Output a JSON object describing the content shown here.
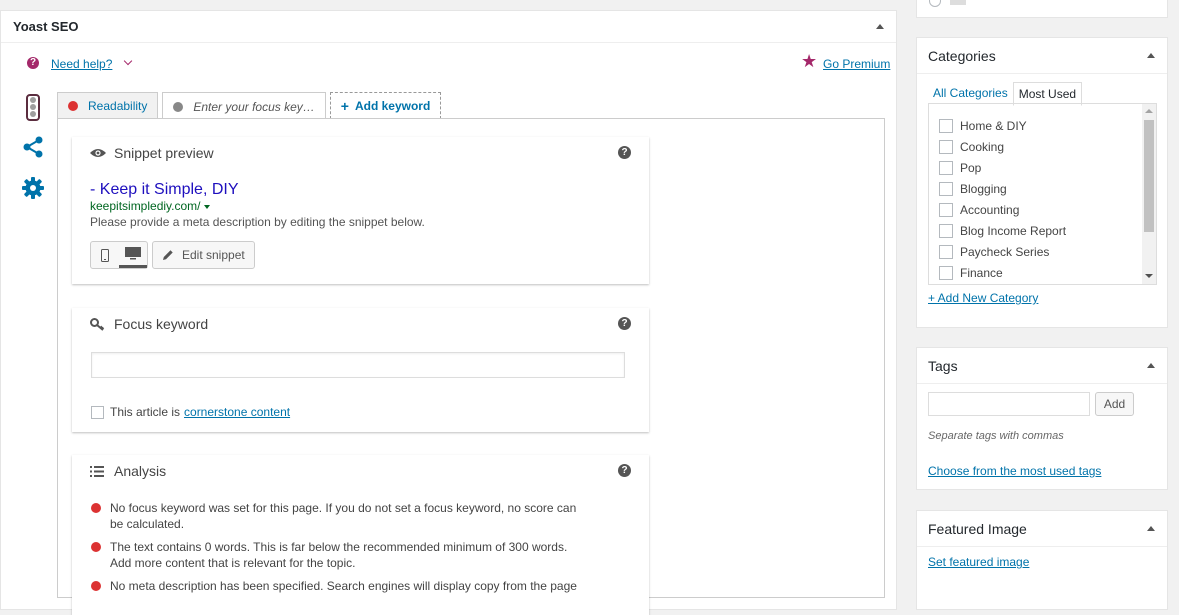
{
  "yoast": {
    "title": "Yoast SEO",
    "need_help": "Need help?",
    "go_premium": "Go Premium",
    "tabs": {
      "readability": "Readability",
      "focus_placeholder": "Enter your focus key…",
      "add_keyword": "Add keyword"
    },
    "snippet": {
      "heading": "Snippet preview",
      "title": "- Keep it Simple, DIY",
      "url": "keepitsimplediy.com/",
      "description": "Please provide a meta description by editing the snippet below.",
      "edit_label": "Edit snippet"
    },
    "focus_keyword": {
      "heading": "Focus keyword",
      "value": "",
      "cornerstone_prefix": "This article is",
      "cornerstone_link": "cornerstone content"
    },
    "analysis": {
      "heading": "Analysis",
      "items": [
        "No focus keyword was set for this page. If you do not set a focus keyword, no score can be calculated.",
        "The text contains 0 words. This is far below the recommended minimum of 300 words. Add more content that is relevant for the topic.",
        "No meta description has been specified. Search engines will display copy from the page"
      ]
    }
  },
  "categories": {
    "title": "Categories",
    "tabs": [
      "All Categories",
      "Most Used"
    ],
    "items": [
      "Home & DIY",
      "Cooking",
      "Pop",
      "Blogging",
      "Accounting",
      "Blog Income Report",
      "Paycheck Series",
      "Finance"
    ],
    "add_new": "+ Add New Category"
  },
  "tags": {
    "title": "Tags",
    "add_button": "Add",
    "hint": "Separate tags with commas",
    "choose": "Choose from the most used tags"
  },
  "featured_image": {
    "title": "Featured Image",
    "set_link": "Set featured image"
  },
  "colors": {
    "accent": "#0073aa",
    "yoast_purple": "#a4286a",
    "error_red": "#dc3232",
    "snippet_title": "#1e0fbe",
    "snippet_url": "#006621"
  }
}
